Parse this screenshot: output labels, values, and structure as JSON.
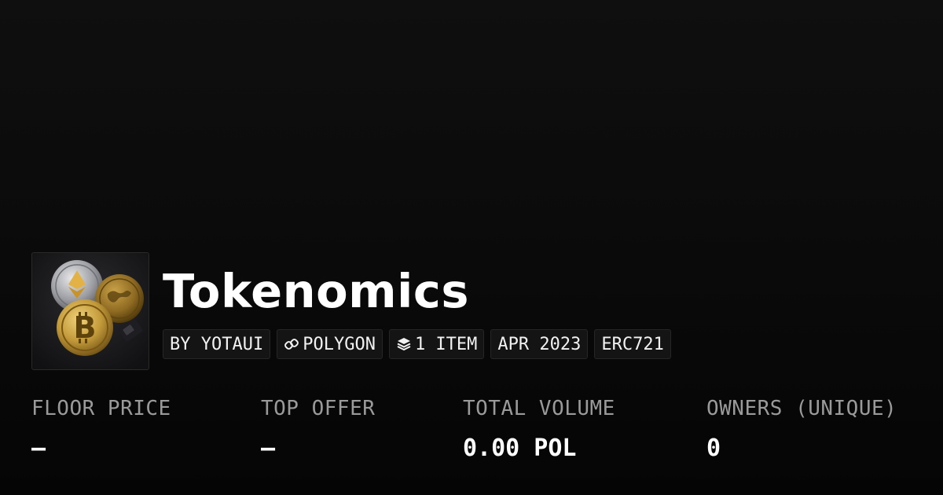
{
  "collection": {
    "name": "Tokenomics",
    "badges": {
      "creator": "BY YOTAUI",
      "chain": "POLYGON",
      "items": "1 ITEM",
      "date": "APR 2023",
      "standard": "ERC721"
    }
  },
  "stats": {
    "floor_price": {
      "label": "FLOOR PRICE",
      "value": "–"
    },
    "top_offer": {
      "label": "TOP OFFER",
      "value": "–"
    },
    "total_volume": {
      "label": "TOTAL VOLUME",
      "value": "0.00 POL"
    },
    "owners": {
      "label": "OWNERS (UNIQUE)",
      "value": "0"
    }
  },
  "icons": {
    "chain": "link-icon",
    "items": "layers-icon"
  },
  "colors": {
    "background": "#0a0a0a",
    "label": "#9a9a9a",
    "text": "#ffffff",
    "badge_bg": "#141414",
    "badge_border": "#262626"
  }
}
